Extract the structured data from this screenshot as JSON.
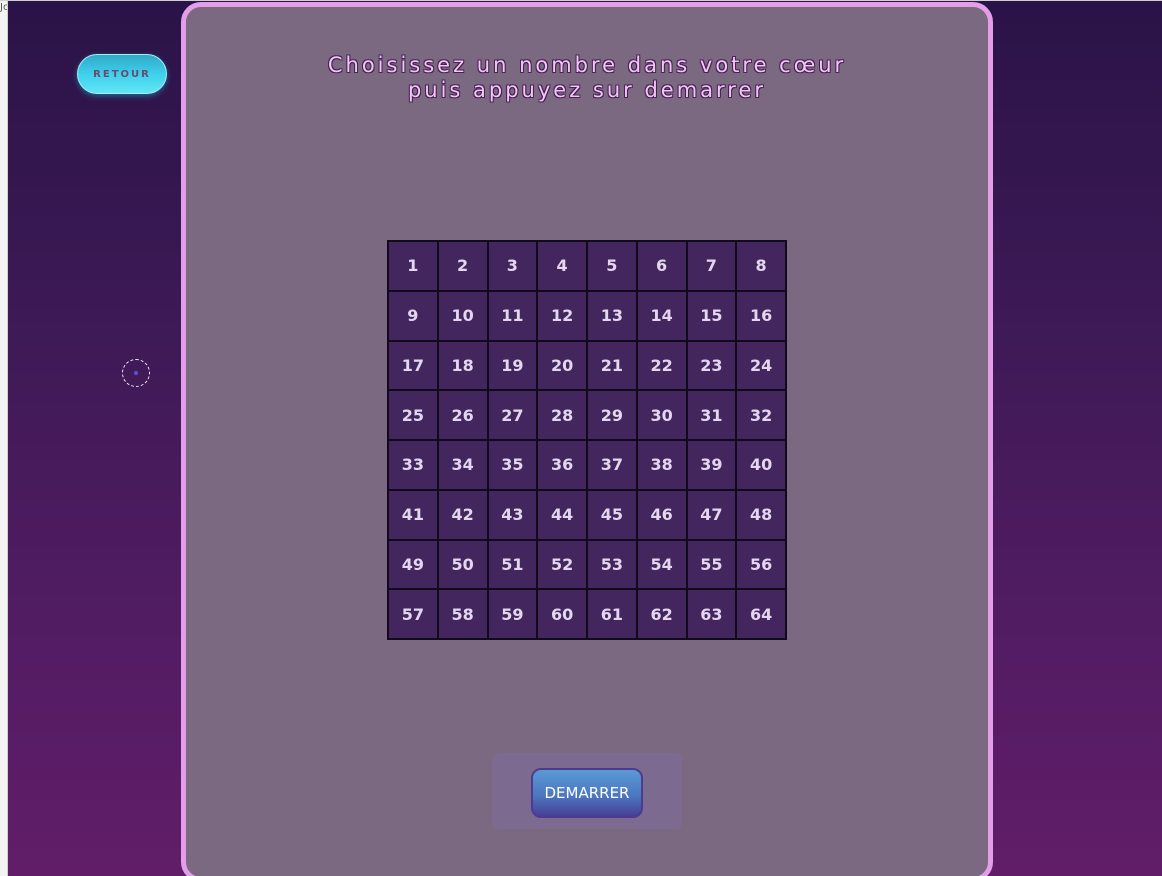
{
  "page": {
    "strip_text": "Jo"
  },
  "header": {
    "back_label": "RETOUR"
  },
  "game": {
    "instruction_line1": "Choisissez un nombre dans votre cœur",
    "instruction_line2": "puis appuyez sur demarrer",
    "grid_numbers": [
      1,
      2,
      3,
      4,
      5,
      6,
      7,
      8,
      9,
      10,
      11,
      12,
      13,
      14,
      15,
      16,
      17,
      18,
      19,
      20,
      21,
      22,
      23,
      24,
      25,
      26,
      27,
      28,
      29,
      30,
      31,
      32,
      33,
      34,
      35,
      36,
      37,
      38,
      39,
      40,
      41,
      42,
      43,
      44,
      45,
      46,
      47,
      48,
      49,
      50,
      51,
      52,
      53,
      54,
      55,
      56,
      57,
      58,
      59,
      60,
      61,
      62,
      63,
      64
    ],
    "start_label": "DEMARRER"
  },
  "colors": {
    "panel_border": "#e39de9",
    "panel_background": "#7b6981",
    "cell_background": "#43265d",
    "instruction_text": "#f2c6f6",
    "back_button": "#3fd0ec"
  }
}
